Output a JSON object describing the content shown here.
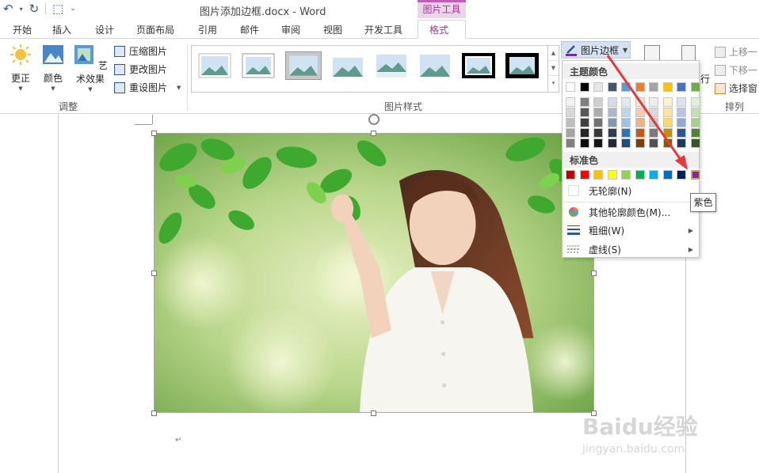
{
  "titlebar": {
    "doc_title": "图片添加边框.docx - Word",
    "context_tab": "图片工具"
  },
  "tabs": [
    "开始",
    "插入",
    "设计",
    "页面布局",
    "引用",
    "邮件",
    "审阅",
    "视图",
    "开发工具"
  ],
  "active_tab": "格式",
  "ribbon": {
    "adjust": {
      "correct": "更正",
      "color": "颜色",
      "artistic": "艺术效果",
      "compress": "压缩图片",
      "change": "更改图片",
      "reset": "重设图片",
      "group_label": "调整"
    },
    "styles_group_label": "图片样式",
    "border_button": "图片边框",
    "arrange": {
      "bring_forward": "上移一",
      "send_backward": "下移一",
      "selection_pane": "选择窗",
      "group_label": "排列",
      "partial_button": "行"
    }
  },
  "dropdown": {
    "theme_colors_title": "主题颜色",
    "standard_colors_title": "标准色",
    "theme_top": [
      "#ffffff",
      "#000000",
      "#e7e6e6",
      "#44546a",
      "#5b9bd5",
      "#ed7d31",
      "#a5a5a5",
      "#ffc000",
      "#4472c4",
      "#70ad47"
    ],
    "theme_shades": [
      [
        "#f2f2f2",
        "#7f7f7f",
        "#d0cece",
        "#d6dce4",
        "#deebf6",
        "#fbe5d5",
        "#ededed",
        "#fff2cc",
        "#dae3f3",
        "#e2efd9"
      ],
      [
        "#d8d8d8",
        "#595959",
        "#aeabab",
        "#adb9ca",
        "#bdd7ee",
        "#f8cbad",
        "#dbdbdb",
        "#fee599",
        "#b4c6e7",
        "#c5e0b3"
      ],
      [
        "#bfbfbf",
        "#3f3f3f",
        "#757070",
        "#8496b0",
        "#9dc3e6",
        "#f4b183",
        "#c9c9c9",
        "#ffd965",
        "#8eaadb",
        "#a8d08d"
      ],
      [
        "#a5a5a5",
        "#262626",
        "#3a3838",
        "#323f4f",
        "#2e75b5",
        "#c55a11",
        "#7b7b7b",
        "#bf9000",
        "#2f5496",
        "#538135"
      ],
      [
        "#7f7f7f",
        "#0c0c0c",
        "#171616",
        "#222a35",
        "#1e4e79",
        "#833c0b",
        "#525252",
        "#7f6000",
        "#1f3864",
        "#375623"
      ]
    ],
    "standard": [
      "#c00000",
      "#ff0000",
      "#ffc000",
      "#ffff00",
      "#92d050",
      "#00b050",
      "#00b0f0",
      "#0070c0",
      "#002060",
      "#7030a0"
    ],
    "selected_standard_index": 9,
    "no_outline": "无轮廓(N)",
    "more_colors": "其他轮廓颜色(M)...",
    "weight": "粗细(W)",
    "dashes": "虚线(S)"
  },
  "tooltip": "紫色",
  "watermark": {
    "logo": "Baidu经验",
    "url": "jingyan.baidu.com"
  },
  "colors": {
    "accent": "#a1378f",
    "arrow": "#e8383d",
    "pen_underline": "#7030a0"
  }
}
